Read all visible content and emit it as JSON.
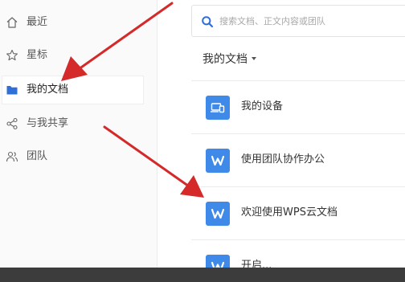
{
  "sidebar": {
    "items": [
      {
        "label": "最近",
        "icon": "home-icon"
      },
      {
        "label": "星标",
        "icon": "star-icon"
      },
      {
        "label": "我的文档",
        "icon": "folder-icon"
      },
      {
        "label": "与我共享",
        "icon": "share-icon"
      },
      {
        "label": "团队",
        "icon": "team-icon"
      }
    ],
    "active_index": 2
  },
  "search": {
    "placeholder": "搜索文档、正文内容或团队"
  },
  "main": {
    "folder_title": "我的文档",
    "files": [
      {
        "label": "我的设备",
        "icon": "device-folder-icon"
      },
      {
        "label": "使用团队协作办公",
        "icon": "wps-writer-icon"
      },
      {
        "label": "欢迎使用WPS云文档",
        "icon": "wps-writer-icon"
      },
      {
        "label": "开启...",
        "icon": "wps-writer-icon"
      }
    ]
  },
  "colors": {
    "accent": "#3f8ae8",
    "arrow": "#d42a2a",
    "taskbar": "#3c3c3c"
  }
}
